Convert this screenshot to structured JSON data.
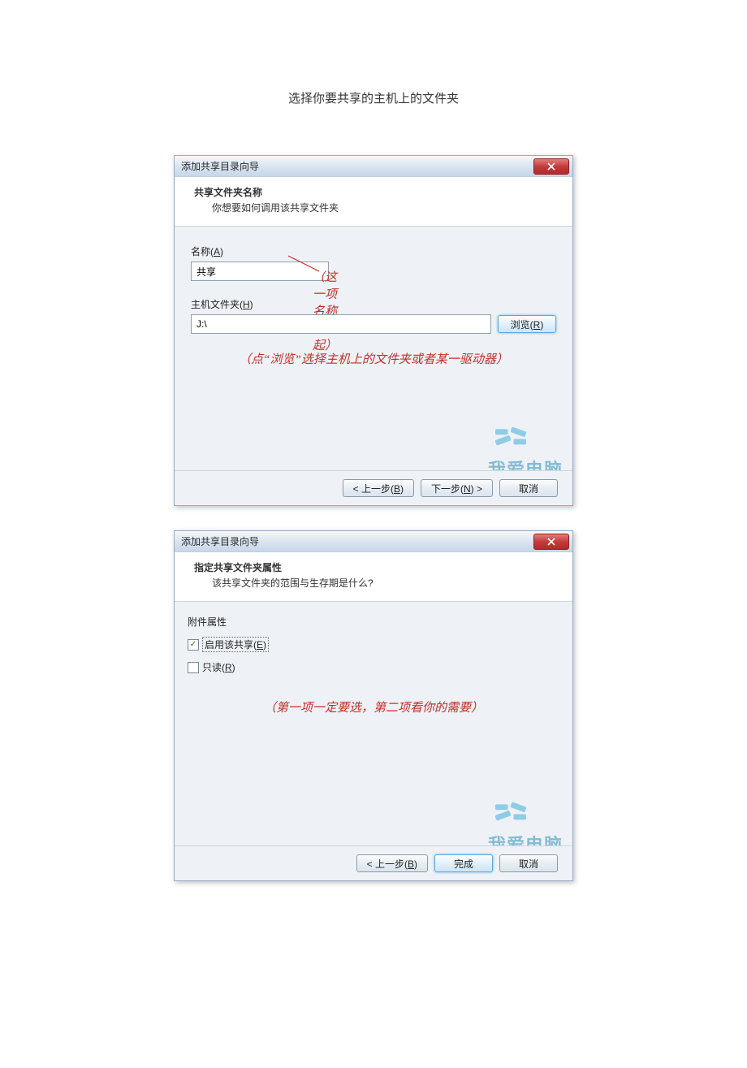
{
  "caption": "选择你要共享的主机上的文件夹",
  "dialog1": {
    "title": "添加共享目录向导",
    "header": {
      "line1": "共享文件夹名称",
      "line2": "你想要如何调用该共享文件夹"
    },
    "name_label": "名称(A)",
    "name_value": "共享",
    "name_annotation": "（这一项名称任意起）",
    "host_label": "主机文件夹(H)",
    "host_value": "J:\\",
    "browse_label": "浏览(R)",
    "browse_annotation": "（点“浏览”选择主机上的文件夹或者某一驱动器）",
    "buttons": {
      "back": "< 上一步(B)",
      "next": "下一步(N) >",
      "cancel": "取消"
    }
  },
  "dialog2": {
    "title": "添加共享目录向导",
    "header": {
      "line1": "指定共享文件夹属性",
      "line2": "该共享文件夹的范围与生存期是什么?"
    },
    "attr_title": "附件属性",
    "check1": {
      "checked": true,
      "label": "启用该共享(E)"
    },
    "check2": {
      "checked": false,
      "label": "只读(R)"
    },
    "annotation": "（第一项一定要选，第二项看你的需要）",
    "buttons": {
      "back": "< 上一步(B)",
      "finish": "完成",
      "cancel": "取消"
    }
  },
  "watermark_text": "我爱电脑"
}
